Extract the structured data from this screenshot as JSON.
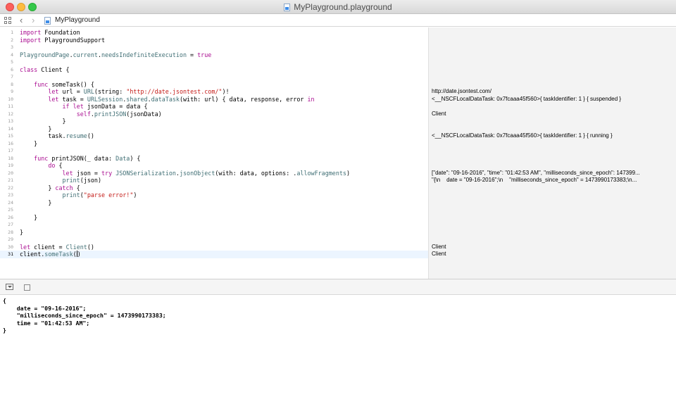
{
  "window": {
    "title": "MyPlayground.playground"
  },
  "jumpbar": {
    "label": "MyPlayground"
  },
  "icons": {
    "close": "close-button-circle",
    "minimize": "minimize-button-circle",
    "zoom": "zoom-button-circle",
    "related": "grid-icon",
    "back": "chevron-left-icon",
    "forward": "chevron-right-icon",
    "document": "playground-file-icon",
    "debug_toggle": "hide-debug-area-icon",
    "debug_square": "square-icon"
  },
  "colors": {
    "keyword": "#aa0d91",
    "type": "#3f6e74",
    "string": "#c41a16",
    "results_background": "#f3f3f3",
    "current_line": "#ecf5ff"
  },
  "editor": {
    "current_line": 31,
    "lines": [
      {
        "n": "1",
        "t": [
          {
            "k": "kw",
            "s": "import"
          },
          {
            "k": "",
            "s": " Foundation"
          }
        ]
      },
      {
        "n": "2",
        "t": [
          {
            "k": "kw",
            "s": "import"
          },
          {
            "k": "",
            "s": " PlaygroundSupport"
          }
        ]
      },
      {
        "n": "3",
        "t": []
      },
      {
        "n": "4",
        "t": [
          {
            "k": "ty",
            "s": "PlaygroundPage"
          },
          {
            "k": "",
            "s": "."
          },
          {
            "k": "mb",
            "s": "current"
          },
          {
            "k": "",
            "s": "."
          },
          {
            "k": "mb",
            "s": "needsIndefiniteExecution"
          },
          {
            "k": "",
            "s": " = "
          },
          {
            "k": "kw",
            "s": "true"
          }
        ]
      },
      {
        "n": "5",
        "t": []
      },
      {
        "n": "6",
        "t": [
          {
            "k": "kw",
            "s": "class"
          },
          {
            "k": "",
            "s": " Client {"
          }
        ]
      },
      {
        "n": "7",
        "t": []
      },
      {
        "n": "8",
        "t": [
          {
            "k": "",
            "s": "    "
          },
          {
            "k": "kw",
            "s": "func"
          },
          {
            "k": "",
            "s": " someTask() {"
          }
        ]
      },
      {
        "n": "9",
        "t": [
          {
            "k": "",
            "s": "        "
          },
          {
            "k": "kw",
            "s": "let"
          },
          {
            "k": "",
            "s": " url = "
          },
          {
            "k": "ty",
            "s": "URL"
          },
          {
            "k": "",
            "s": "(string: "
          },
          {
            "k": "str",
            "s": "\"http://date.jsontest.com/\""
          },
          {
            "k": "",
            "s": ")!"
          }
        ]
      },
      {
        "n": "10",
        "t": [
          {
            "k": "",
            "s": "        "
          },
          {
            "k": "kw",
            "s": "let"
          },
          {
            "k": "",
            "s": " task = "
          },
          {
            "k": "ty",
            "s": "URLSession"
          },
          {
            "k": "",
            "s": "."
          },
          {
            "k": "mb",
            "s": "shared"
          },
          {
            "k": "",
            "s": "."
          },
          {
            "k": "mb",
            "s": "dataTask"
          },
          {
            "k": "",
            "s": "(with: url) { data, response, error "
          },
          {
            "k": "kw",
            "s": "in"
          }
        ]
      },
      {
        "n": "11",
        "t": [
          {
            "k": "",
            "s": "            "
          },
          {
            "k": "kw",
            "s": "if let"
          },
          {
            "k": "",
            "s": " jsonData = data {"
          }
        ]
      },
      {
        "n": "12",
        "t": [
          {
            "k": "",
            "s": "                "
          },
          {
            "k": "kw",
            "s": "self"
          },
          {
            "k": "",
            "s": "."
          },
          {
            "k": "mb",
            "s": "printJSON"
          },
          {
            "k": "",
            "s": "(jsonData)"
          }
        ]
      },
      {
        "n": "13",
        "t": [
          {
            "k": "",
            "s": "            }"
          }
        ]
      },
      {
        "n": "14",
        "t": [
          {
            "k": "",
            "s": "        }"
          }
        ]
      },
      {
        "n": "15",
        "t": [
          {
            "k": "",
            "s": "        task."
          },
          {
            "k": "mb",
            "s": "resume"
          },
          {
            "k": "",
            "s": "()"
          }
        ]
      },
      {
        "n": "16",
        "t": [
          {
            "k": "",
            "s": "    }"
          }
        ]
      },
      {
        "n": "17",
        "t": []
      },
      {
        "n": "18",
        "t": [
          {
            "k": "",
            "s": "    "
          },
          {
            "k": "kw",
            "s": "func"
          },
          {
            "k": "",
            "s": " printJSON(_ data: "
          },
          {
            "k": "ty",
            "s": "Data"
          },
          {
            "k": "",
            "s": ") {"
          }
        ]
      },
      {
        "n": "19",
        "t": [
          {
            "k": "",
            "s": "        "
          },
          {
            "k": "kw",
            "s": "do"
          },
          {
            "k": "",
            "s": " {"
          }
        ]
      },
      {
        "n": "20",
        "t": [
          {
            "k": "",
            "s": "            "
          },
          {
            "k": "kw",
            "s": "let"
          },
          {
            "k": "",
            "s": " json = "
          },
          {
            "k": "kw",
            "s": "try"
          },
          {
            "k": "",
            "s": " "
          },
          {
            "k": "ty",
            "s": "JSONSerialization"
          },
          {
            "k": "",
            "s": "."
          },
          {
            "k": "mb",
            "s": "jsonObject"
          },
          {
            "k": "",
            "s": "(with: data, options: ."
          },
          {
            "k": "mb",
            "s": "allowFragments"
          },
          {
            "k": "",
            "s": ")"
          }
        ]
      },
      {
        "n": "21",
        "t": [
          {
            "k": "",
            "s": "            "
          },
          {
            "k": "mb",
            "s": "print"
          },
          {
            "k": "",
            "s": "(json)"
          }
        ]
      },
      {
        "n": "22",
        "t": [
          {
            "k": "",
            "s": "        } "
          },
          {
            "k": "kw",
            "s": "catch"
          },
          {
            "k": "",
            "s": " {"
          }
        ]
      },
      {
        "n": "23",
        "t": [
          {
            "k": "",
            "s": "            "
          },
          {
            "k": "mb",
            "s": "print"
          },
          {
            "k": "",
            "s": "("
          },
          {
            "k": "str",
            "s": "\"parse error!\""
          },
          {
            "k": "",
            "s": ")"
          }
        ]
      },
      {
        "n": "24",
        "t": [
          {
            "k": "",
            "s": "        }"
          }
        ]
      },
      {
        "n": "25",
        "t": []
      },
      {
        "n": "26",
        "t": [
          {
            "k": "",
            "s": "    }"
          }
        ]
      },
      {
        "n": "27",
        "t": []
      },
      {
        "n": "28",
        "t": [
          {
            "k": "",
            "s": "}"
          }
        ]
      },
      {
        "n": "29",
        "t": []
      },
      {
        "n": "30",
        "t": [
          {
            "k": "kw",
            "s": "let"
          },
          {
            "k": "",
            "s": " client = "
          },
          {
            "k": "ty",
            "s": "Client"
          },
          {
            "k": "",
            "s": "()"
          }
        ]
      },
      {
        "n": "31",
        "t": [
          {
            "k": "",
            "s": "client."
          },
          {
            "k": "mb",
            "s": "someTask"
          },
          {
            "k": "",
            "s": "()"
          }
        ]
      }
    ]
  },
  "results": [
    {
      "line": 9,
      "text": "http://date.jsontest.com/"
    },
    {
      "line": 10,
      "text": "<__NSCFLocalDataTask: 0x7fcaaa45f560>{ taskIdentifier: 1 } { suspended }"
    },
    {
      "line": 12,
      "text": "Client"
    },
    {
      "line": 15,
      "text": "<__NSCFLocalDataTask: 0x7fcaaa45f560>{ taskIdentifier: 1 } { running }"
    },
    {
      "line": 20,
      "text": "[\"date\": \"09-16-2016\", \"time\": \"01:42:53 AM\", \"milliseconds_since_epoch\": 147399..."
    },
    {
      "line": 21,
      "text": "\"{\\n    date = \"09-16-2016\";\\n    \"milliseconds_since_epoch\" = 1473990173383;\\n..."
    },
    {
      "line": 30,
      "text": "Client"
    },
    {
      "line": 31,
      "text": "Client"
    }
  ],
  "console": {
    "lines": [
      "{",
      "    date = \"09-16-2016\";",
      "    \"milliseconds_since_epoch\" = 1473990173383;",
      "    time = \"01:42:53 AM\";",
      "}"
    ]
  }
}
